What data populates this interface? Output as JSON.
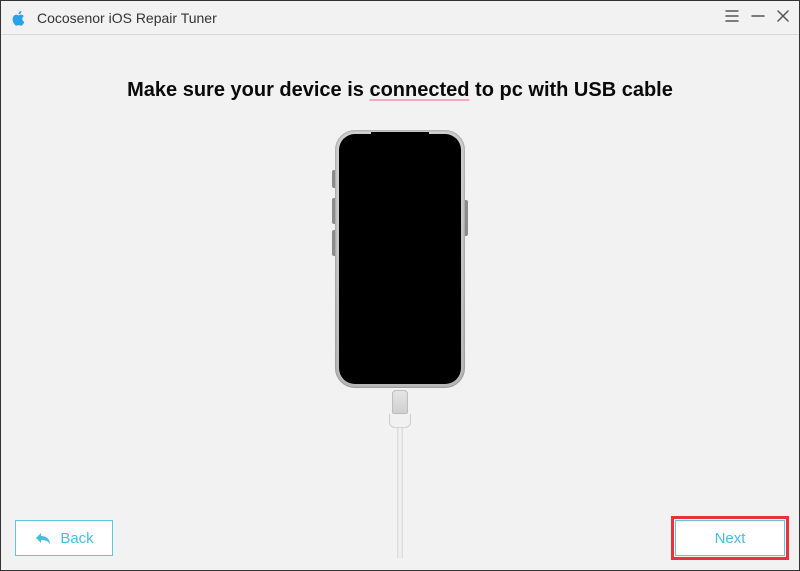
{
  "window": {
    "title": "Cocosenor iOS Repair Tuner"
  },
  "instruction": {
    "prefix": "Make sure your device is ",
    "emphasis": "connected",
    "suffix": " to pc with USB cable"
  },
  "buttons": {
    "back": "Back",
    "next": "Next"
  },
  "icons": {
    "logo": "apple-logo",
    "menu": "menu",
    "minimize": "minimize",
    "close": "close",
    "back_arrow": "reply-arrow"
  }
}
